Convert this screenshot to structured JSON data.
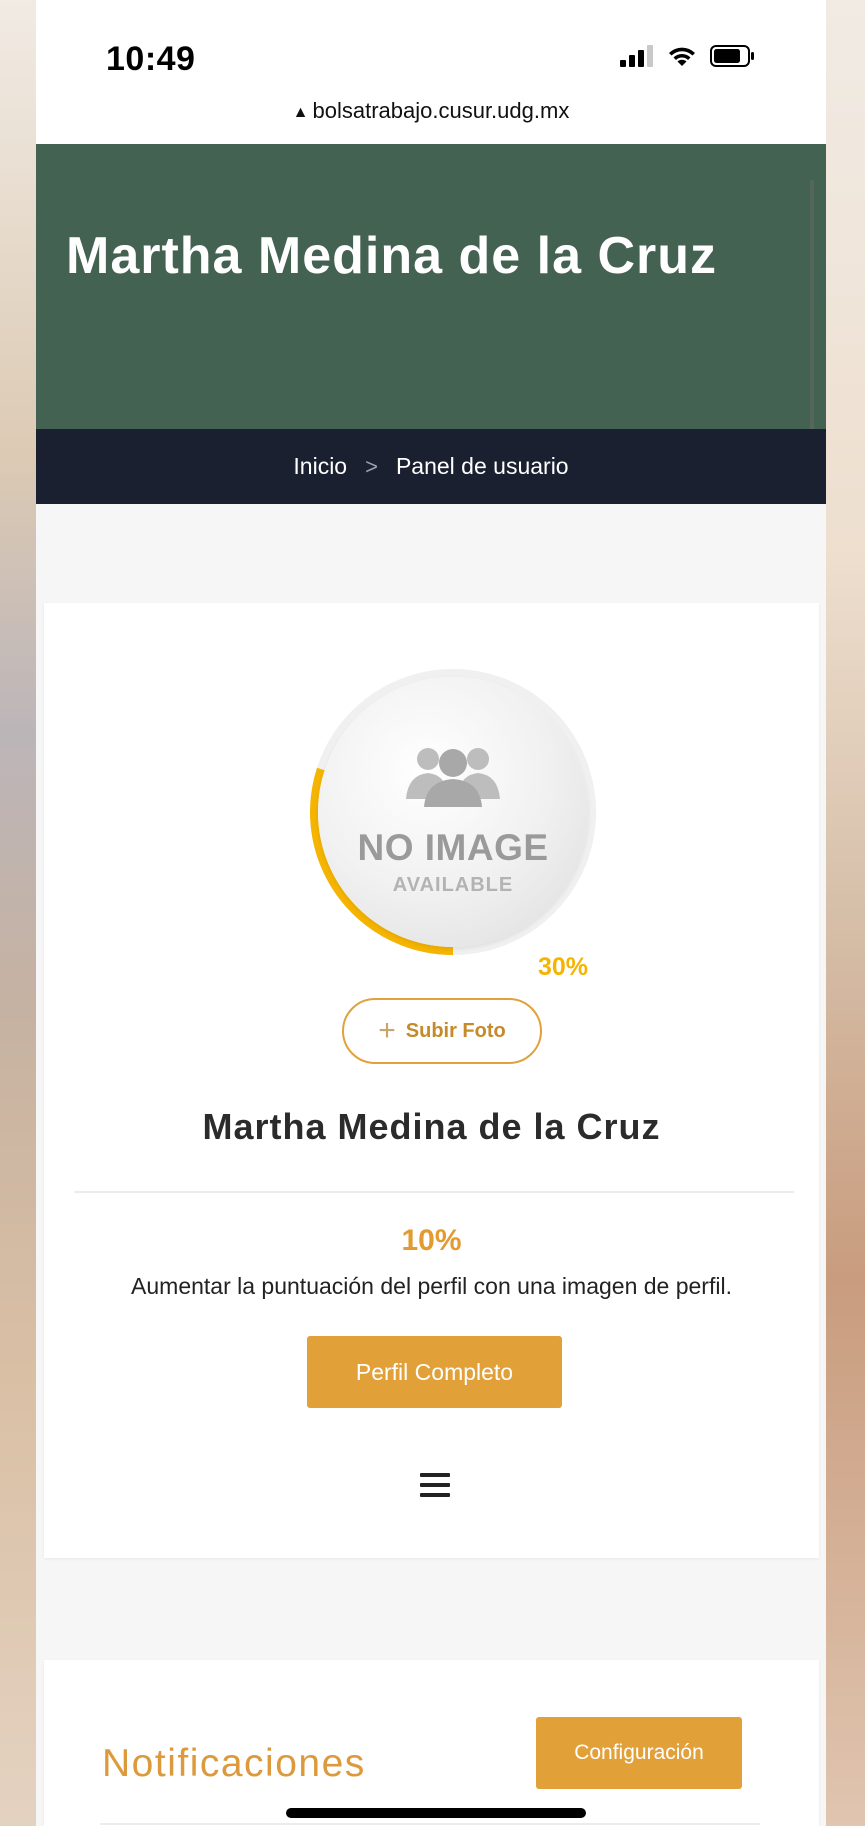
{
  "status_bar": {
    "time": "10:49",
    "url": "bolsatrabajo.cusur.udg.mx"
  },
  "hero": {
    "title": "Martha Medina de la Cruz"
  },
  "breadcrumb": {
    "home": "Inicio",
    "separator": ">",
    "current": "Panel de usuario"
  },
  "profile_card": {
    "avatar_line1": "NO IMAGE",
    "avatar_line2": "AVAILABLE",
    "progress_percent": 30,
    "progress_label": "30%",
    "upload_button": "Subir Foto",
    "name": "Martha Medina de la Cruz",
    "score_percent": "10%",
    "score_message": "Aumentar la puntuación del perfil con una imagen de perfil.",
    "complete_button": "Perfil Completo"
  },
  "notifications_card": {
    "title": "Notificaciones",
    "config_button": "Configuración"
  },
  "colors": {
    "hero_bg": "#446252",
    "breadcrumb_bg": "#1a2030",
    "accent": "#e2a038",
    "progress": "#f5b400"
  }
}
